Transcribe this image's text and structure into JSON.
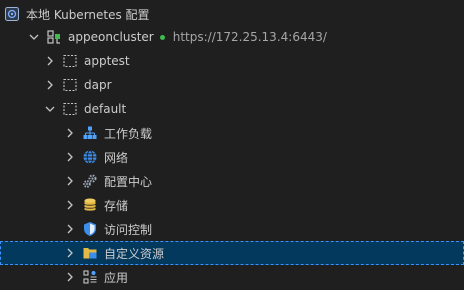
{
  "colors": {
    "background": "#1f1f1f",
    "selection": "#04395e",
    "focus_border": "#3794ff",
    "status_dot": "#3fb950"
  },
  "tree": {
    "root": {
      "label": "本地 Kubernetes 配置",
      "icon": "kubernetes-icon"
    },
    "cluster": {
      "label": "appeoncluster",
      "url": "https://172.25.13.4:6443/",
      "status": "connected",
      "icon": "cluster-icon"
    },
    "namespaces": [
      {
        "label": "apptest",
        "icon": "namespace-icon"
      },
      {
        "label": "dapr",
        "icon": "namespace-icon"
      },
      {
        "label": "default",
        "icon": "namespace-icon"
      }
    ],
    "default_children": [
      {
        "label": "工作负载",
        "icon": "workloads-icon"
      },
      {
        "label": "网络",
        "icon": "globe-icon"
      },
      {
        "label": "配置中心",
        "icon": "gears-icon"
      },
      {
        "label": "存储",
        "icon": "database-icon"
      },
      {
        "label": "访问控制",
        "icon": "shield-icon"
      },
      {
        "label": "自定义资源",
        "icon": "folder-icon",
        "selected": true
      },
      {
        "label": "应用",
        "icon": "apps-icon"
      }
    ]
  }
}
